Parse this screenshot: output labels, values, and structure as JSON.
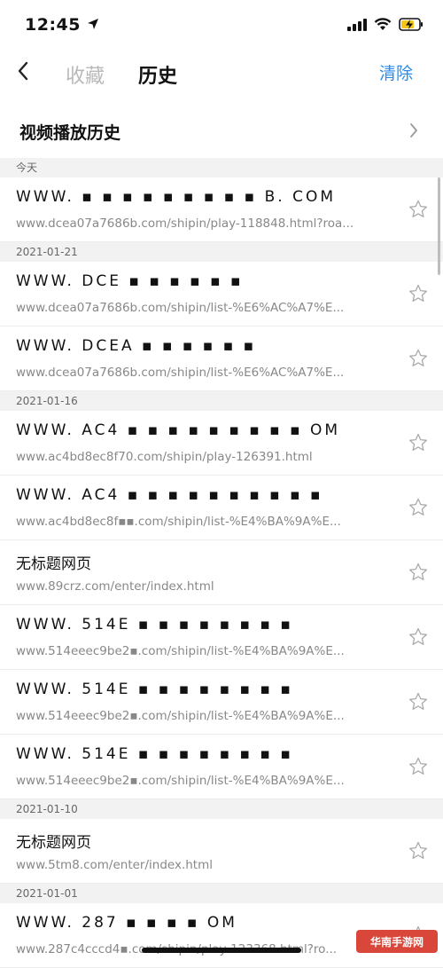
{
  "status": {
    "time": "12:45"
  },
  "nav": {
    "tab_favorites": "收藏",
    "tab_history": "历史",
    "clear": "清除"
  },
  "video_history": {
    "label": "视频播放历史"
  },
  "groups": [
    {
      "date": "今天",
      "items": [
        {
          "title": "WWW.  ▪ ▪ ▪ ▪ ▪ ▪ ▪  ▪ ▪ B. COM",
          "url": "www.dcea07a7686b.com/shipin/play-118848.html?roa..."
        }
      ]
    },
    {
      "date": "2021-01-21",
      "items": [
        {
          "title": "WWW. DCE ▪ ▪   ▪ ▪ ▪ ▪",
          "url": "www.dcea07a7686b.com/shipin/list-%E6%AC%A7%E..."
        },
        {
          "title": "WWW. DCEA ▪ ▪   ▪ ▪ ▪ ▪",
          "url": "www.dcea07a7686b.com/shipin/list-%E6%AC%A7%E..."
        }
      ]
    },
    {
      "date": "2021-01-16",
      "items": [
        {
          "title": "WWW. AC4 ▪ ▪ ▪ ▪ ▪ ▪ ▪  ▪ ▪  OM",
          "url": "www.ac4bd8ec8f70.com/shipin/play-126391.html"
        },
        {
          "title": "WWW. AC4 ▪ ▪ ▪ ▪ ▪ ▪  ▪ ▪ ▪ ▪",
          "url": "www.ac4bd8ec8f▪▪.com/shipin/list-%E4%BA%9A%E..."
        },
        {
          "title": "无标题网页",
          "url": "www.89crz.com/enter/index.html"
        },
        {
          "title": "WWW. 514E ▪ ▪ ▪ ▪ ▪ ▪ ▪ ▪",
          "url": "www.514eeec9be2▪.com/shipin/list-%E4%BA%9A%E..."
        },
        {
          "title": "WWW. 514E ▪ ▪ ▪ ▪ ▪ ▪ ▪ ▪",
          "url": "www.514eeec9be2▪.com/shipin/list-%E4%BA%9A%E..."
        },
        {
          "title": "WWW. 514E ▪ ▪ ▪ ▪ ▪ ▪ ▪ ▪",
          "url": "www.514eeec9be2▪.com/shipin/list-%E4%BA%9A%E..."
        }
      ]
    },
    {
      "date": "2021-01-10",
      "items": [
        {
          "title": "无标题网页",
          "url": "www.5tm8.com/enter/index.html"
        }
      ]
    },
    {
      "date": "2021-01-01",
      "items": [
        {
          "title": "WWW. 287 ▪ ▪ ▪ ▪  OM",
          "url": "www.287c4cccd4▪.com/shipin/play-123368.html?ro..."
        }
      ]
    }
  ],
  "watermark": {
    "text": "华南手游网"
  },
  "colors": {
    "accent": "#2b8be6",
    "inactive_tab": "#b9b9b9",
    "section_bg": "#f2f2f2"
  }
}
